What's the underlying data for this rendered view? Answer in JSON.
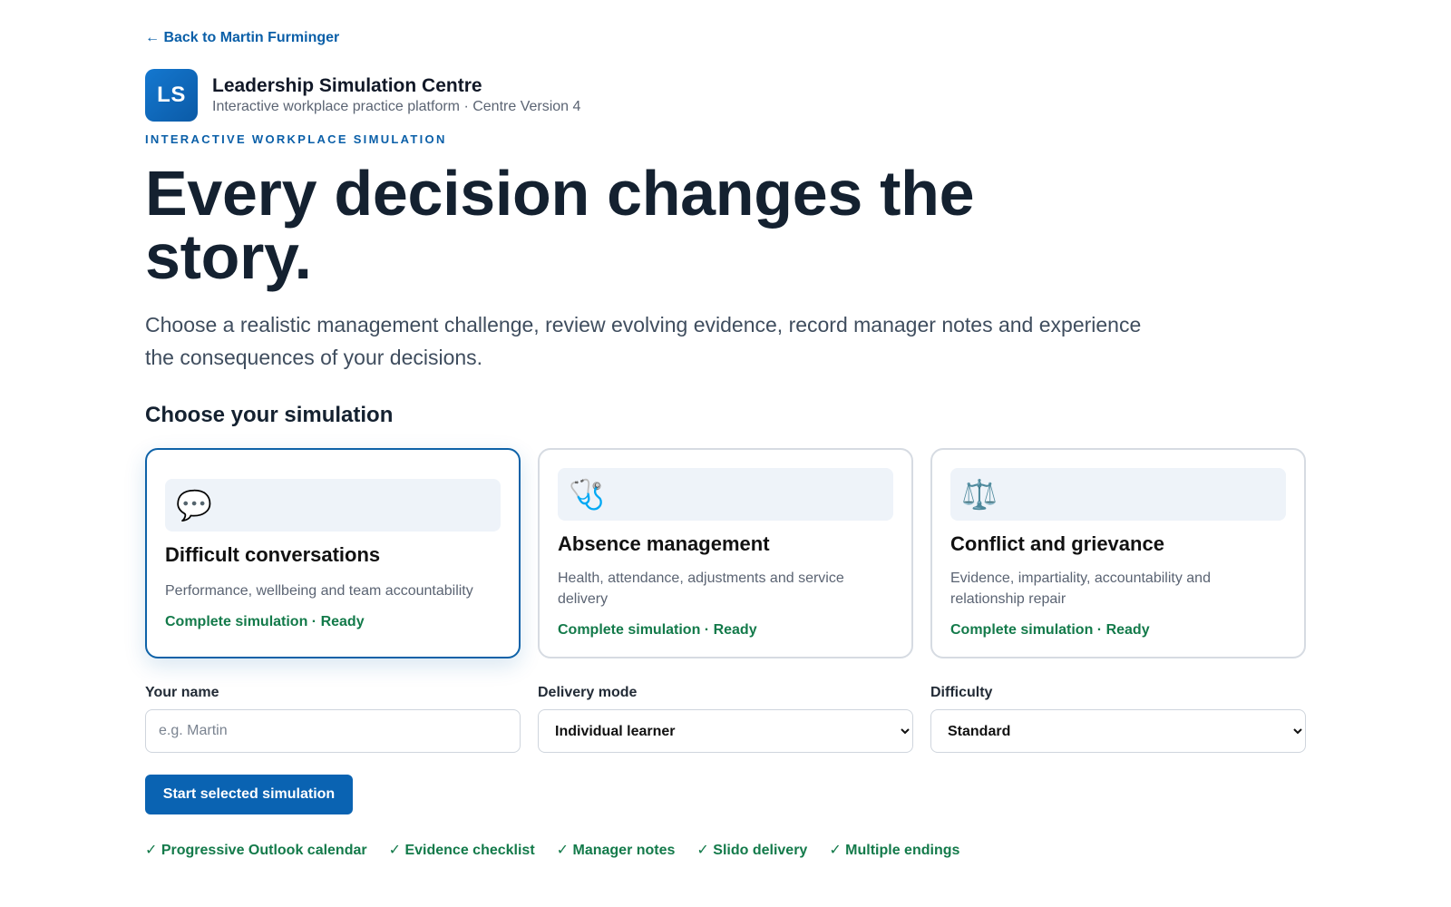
{
  "nav": {
    "back_link": "← Back to Martin Furminger"
  },
  "brand": {
    "logo_initials": "LS",
    "name": "Leadership Simulation Centre",
    "subtitle": "Interactive workplace practice platform · Centre Version 4",
    "accent_color": "#0a5fa8"
  },
  "hero": {
    "eyebrow": "INTERACTIVE WORKPLACE SIMULATION",
    "title": "Every decision changes the story.",
    "description": "Choose a realistic management challenge, review evolving evidence, record manager notes and experience the consequences of your decisions."
  },
  "simulations": {
    "heading": "Choose your simulation",
    "cards": [
      {
        "icon": "💬",
        "icon_name": "speech-bubble-icon",
        "title": "Difficult conversations",
        "description": "Performance, wellbeing and team accountability",
        "status": "Complete simulation · Ready",
        "selected": true
      },
      {
        "icon": "🩺",
        "icon_name": "stethoscope-icon",
        "title": "Absence management",
        "description": "Health, attendance, adjustments and service delivery",
        "status": "Complete simulation · Ready",
        "selected": false
      },
      {
        "icon": "⚖️",
        "icon_name": "scales-icon",
        "title": "Conflict and grievance",
        "description": "Evidence, impartiality, accountability and relationship repair",
        "status": "Complete simulation · Ready",
        "selected": false
      }
    ]
  },
  "form": {
    "name_label": "Your name",
    "name_placeholder": "e.g. Martin",
    "name_value": "",
    "delivery_label": "Delivery mode",
    "delivery_value": "Individual learner",
    "difficulty_label": "Difficulty",
    "difficulty_value": "Standard",
    "start_button": "Start selected simulation"
  },
  "features": [
    "✓ Progressive Outlook calendar",
    "✓ Evidence checklist",
    "✓ Manager notes",
    "✓ Slido delivery",
    "✓ Multiple endings"
  ]
}
